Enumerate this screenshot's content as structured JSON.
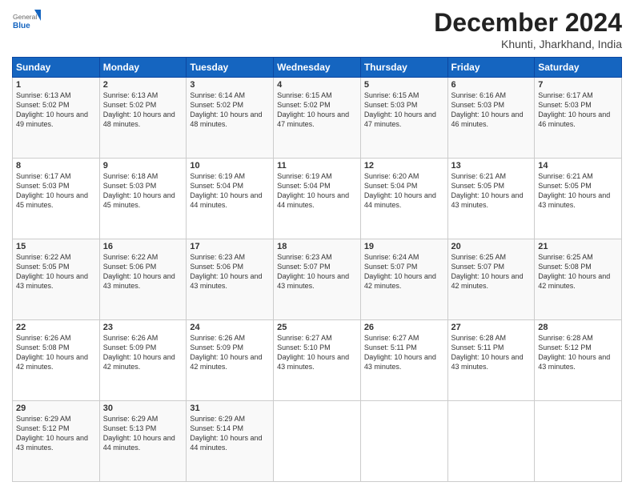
{
  "logo": {
    "general": "General",
    "blue": "Blue"
  },
  "header": {
    "title": "December 2024",
    "subtitle": "Khunti, Jharkhand, India"
  },
  "weekdays": [
    "Sunday",
    "Monday",
    "Tuesday",
    "Wednesday",
    "Thursday",
    "Friday",
    "Saturday"
  ],
  "weeks": [
    [
      {
        "day": "1",
        "sunrise": "6:13 AM",
        "sunset": "5:02 PM",
        "daylight": "10 hours and 49 minutes."
      },
      {
        "day": "2",
        "sunrise": "6:13 AM",
        "sunset": "5:02 PM",
        "daylight": "10 hours and 48 minutes."
      },
      {
        "day": "3",
        "sunrise": "6:14 AM",
        "sunset": "5:02 PM",
        "daylight": "10 hours and 48 minutes."
      },
      {
        "day": "4",
        "sunrise": "6:15 AM",
        "sunset": "5:02 PM",
        "daylight": "10 hours and 47 minutes."
      },
      {
        "day": "5",
        "sunrise": "6:15 AM",
        "sunset": "5:03 PM",
        "daylight": "10 hours and 47 minutes."
      },
      {
        "day": "6",
        "sunrise": "6:16 AM",
        "sunset": "5:03 PM",
        "daylight": "10 hours and 46 minutes."
      },
      {
        "day": "7",
        "sunrise": "6:17 AM",
        "sunset": "5:03 PM",
        "daylight": "10 hours and 46 minutes."
      }
    ],
    [
      {
        "day": "8",
        "sunrise": "6:17 AM",
        "sunset": "5:03 PM",
        "daylight": "10 hours and 45 minutes."
      },
      {
        "day": "9",
        "sunrise": "6:18 AM",
        "sunset": "5:03 PM",
        "daylight": "10 hours and 45 minutes."
      },
      {
        "day": "10",
        "sunrise": "6:19 AM",
        "sunset": "5:04 PM",
        "daylight": "10 hours and 44 minutes."
      },
      {
        "day": "11",
        "sunrise": "6:19 AM",
        "sunset": "5:04 PM",
        "daylight": "10 hours and 44 minutes."
      },
      {
        "day": "12",
        "sunrise": "6:20 AM",
        "sunset": "5:04 PM",
        "daylight": "10 hours and 44 minutes."
      },
      {
        "day": "13",
        "sunrise": "6:21 AM",
        "sunset": "5:05 PM",
        "daylight": "10 hours and 43 minutes."
      },
      {
        "day": "14",
        "sunrise": "6:21 AM",
        "sunset": "5:05 PM",
        "daylight": "10 hours and 43 minutes."
      }
    ],
    [
      {
        "day": "15",
        "sunrise": "6:22 AM",
        "sunset": "5:05 PM",
        "daylight": "10 hours and 43 minutes."
      },
      {
        "day": "16",
        "sunrise": "6:22 AM",
        "sunset": "5:06 PM",
        "daylight": "10 hours and 43 minutes."
      },
      {
        "day": "17",
        "sunrise": "6:23 AM",
        "sunset": "5:06 PM",
        "daylight": "10 hours and 43 minutes."
      },
      {
        "day": "18",
        "sunrise": "6:23 AM",
        "sunset": "5:07 PM",
        "daylight": "10 hours and 43 minutes."
      },
      {
        "day": "19",
        "sunrise": "6:24 AM",
        "sunset": "5:07 PM",
        "daylight": "10 hours and 42 minutes."
      },
      {
        "day": "20",
        "sunrise": "6:25 AM",
        "sunset": "5:07 PM",
        "daylight": "10 hours and 42 minutes."
      },
      {
        "day": "21",
        "sunrise": "6:25 AM",
        "sunset": "5:08 PM",
        "daylight": "10 hours and 42 minutes."
      }
    ],
    [
      {
        "day": "22",
        "sunrise": "6:26 AM",
        "sunset": "5:08 PM",
        "daylight": "10 hours and 42 minutes."
      },
      {
        "day": "23",
        "sunrise": "6:26 AM",
        "sunset": "5:09 PM",
        "daylight": "10 hours and 42 minutes."
      },
      {
        "day": "24",
        "sunrise": "6:26 AM",
        "sunset": "5:09 PM",
        "daylight": "10 hours and 42 minutes."
      },
      {
        "day": "25",
        "sunrise": "6:27 AM",
        "sunset": "5:10 PM",
        "daylight": "10 hours and 43 minutes."
      },
      {
        "day": "26",
        "sunrise": "6:27 AM",
        "sunset": "5:11 PM",
        "daylight": "10 hours and 43 minutes."
      },
      {
        "day": "27",
        "sunrise": "6:28 AM",
        "sunset": "5:11 PM",
        "daylight": "10 hours and 43 minutes."
      },
      {
        "day": "28",
        "sunrise": "6:28 AM",
        "sunset": "5:12 PM",
        "daylight": "10 hours and 43 minutes."
      }
    ],
    [
      {
        "day": "29",
        "sunrise": "6:29 AM",
        "sunset": "5:12 PM",
        "daylight": "10 hours and 43 minutes."
      },
      {
        "day": "30",
        "sunrise": "6:29 AM",
        "sunset": "5:13 PM",
        "daylight": "10 hours and 44 minutes."
      },
      {
        "day": "31",
        "sunrise": "6:29 AM",
        "sunset": "5:14 PM",
        "daylight": "10 hours and 44 minutes."
      },
      null,
      null,
      null,
      null
    ]
  ]
}
